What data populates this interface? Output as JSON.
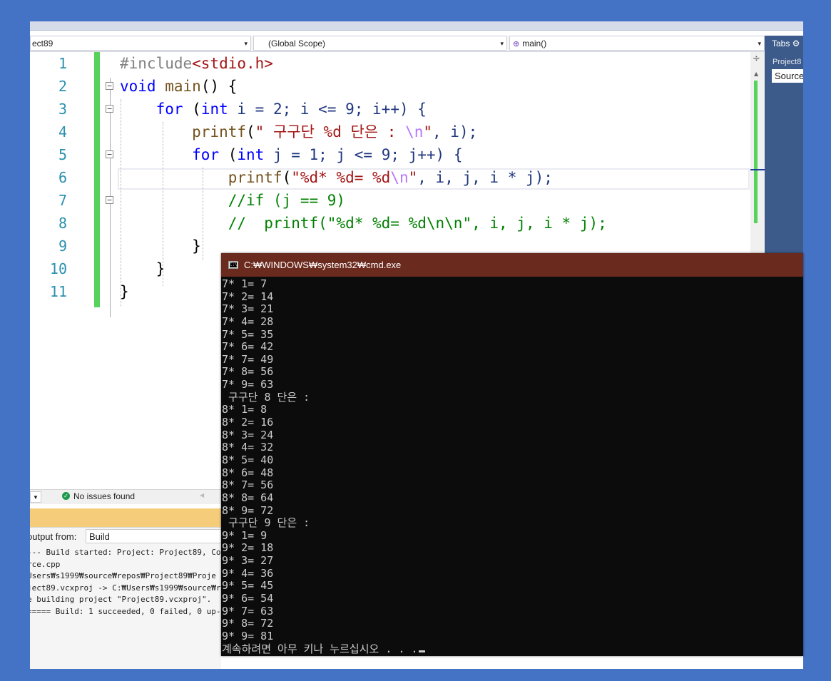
{
  "nav": {
    "project_combo": "ect89",
    "scope_combo": "(Global Scope)",
    "member_combo": "main()",
    "dropdown_glyph": "▾"
  },
  "right_panel": {
    "title": "Tabs ⚙",
    "project": "Project8",
    "source": "Source"
  },
  "editor": {
    "line_numbers": [
      "1",
      "2",
      "3",
      "4",
      "5",
      "6",
      "7",
      "8",
      "9",
      "10",
      "11"
    ],
    "code": {
      "l1_pp": "#include",
      "l1_hdr": "<stdio.h>",
      "l2_kw": "void",
      "l2_fn": "main",
      "l2_rest": "() {",
      "l3_kw": "for",
      "l3_a": " (",
      "l3_int": "int",
      "l3_b": " i = 2; i <= 9; i++) {",
      "l4_fn": "printf",
      "l4_a": "(",
      "l4_str": "\" 구구단 %d 단은 : ",
      "l4_esc": "\\n",
      "l4_q": "\"",
      "l4_rest": ", i);",
      "l5_kw": "for",
      "l5_a": " (",
      "l5_int": "int",
      "l5_b": " j = 1; j <= 9; j++) {",
      "l6_fn": "printf",
      "l6_a": "(",
      "l6_str": "\"%d* %d= %d",
      "l6_esc": "\\n",
      "l6_q": "\"",
      "l6_rest": ", i, j, i * j);",
      "l7_cm": "//if (j == 9)",
      "l8_cm": "//  printf(\"%d* %d= %d\\n\\n\", i, j, i * j);",
      "l9": "}",
      "l10": "}",
      "l11": "}"
    }
  },
  "status": {
    "issues": "No issues found"
  },
  "output": {
    "label": "output from:",
    "source": "Build",
    "lines": [
      "--- Build started: Project: Project89, Co",
      "rce.cpp",
      "Users₩s1999₩source₩repos₩Project89₩Proje",
      "ject89.vcxproj -> C:₩Users₩s1999₩source₩r",
      "e building project \"Project89.vcxproj\".",
      "===== Build: 1 succeeded, 0 failed, 0 up-"
    ]
  },
  "console": {
    "title": "C:₩WINDOWS₩system32₩cmd.exe",
    "lines": [
      "7* 1= 7",
      "7* 2= 14",
      "7* 3= 21",
      "7* 4= 28",
      "7* 5= 35",
      "7* 6= 42",
      "7* 7= 49",
      "7* 8= 56",
      "7* 9= 63",
      " 구구단 8 단은 :",
      "8* 1= 8",
      "8* 2= 16",
      "8* 3= 24",
      "8* 4= 32",
      "8* 5= 40",
      "8* 6= 48",
      "8* 7= 56",
      "8* 8= 64",
      "8* 9= 72",
      " 구구단 9 단은 :",
      "9* 1= 9",
      "9* 2= 18",
      "9* 3= 27",
      "9* 4= 36",
      "9* 5= 45",
      "9* 6= 54",
      "9* 7= 63",
      "9* 8= 72",
      "9* 9= 81"
    ],
    "prompt": "계속하려면 아무 키나 누르십시오 . . ."
  }
}
